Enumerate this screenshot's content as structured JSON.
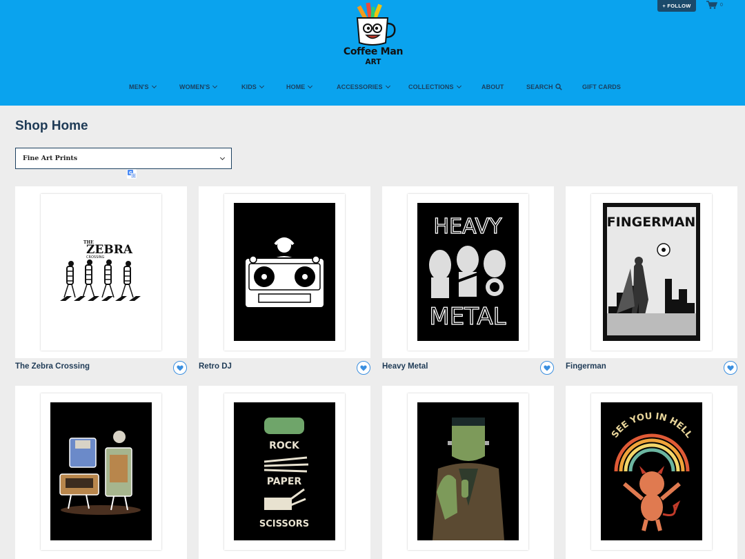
{
  "header": {
    "follow_label": "+ FOLLOW",
    "cart_count": "0",
    "brand_line1": "Coffee Man",
    "brand_line2": "ART"
  },
  "nav": {
    "items": [
      {
        "label": "MEN'S",
        "has_dropdown": true
      },
      {
        "label": "WOMEN'S",
        "has_dropdown": true
      },
      {
        "label": "KIDS",
        "has_dropdown": true
      },
      {
        "label": "HOME",
        "has_dropdown": true
      },
      {
        "label": "ACCESSORIES",
        "has_dropdown": true
      },
      {
        "label": "COLLECTIONS",
        "has_dropdown": true
      },
      {
        "label": "ABOUT",
        "has_dropdown": false
      },
      {
        "label": "SEARCH",
        "has_dropdown": false,
        "icon": "search-icon"
      },
      {
        "label": "GIFT CARDS",
        "has_dropdown": false
      }
    ]
  },
  "page": {
    "title": "Shop Home",
    "filter_value": "Fine Art Prints"
  },
  "products": [
    {
      "title": "The Zebra Crossing",
      "art_text": "ZEBRA",
      "art_text_small": "THE",
      "art_text_small2": "CROSSING"
    },
    {
      "title": "Retro DJ"
    },
    {
      "title": "Heavy Metal",
      "art_text_top": "HEAVY",
      "art_text_bottom": "METAL"
    },
    {
      "title": "Fingerman",
      "art_text": "FINGERMAN"
    },
    {
      "title": ""
    },
    {
      "title": "",
      "art_text_1": "ROCK",
      "art_text_2": "PAPER",
      "art_text_3": "SCISSORS"
    },
    {
      "title": ""
    },
    {
      "title": "",
      "art_text": "SEE YOU IN HELL"
    }
  ],
  "colors": {
    "header_bg": "#0aa3ee",
    "nav_text": "#1b3f5e",
    "page_bg": "#ededed",
    "title_text": "#1f3b56",
    "fav_accent": "#3a8fe0"
  }
}
